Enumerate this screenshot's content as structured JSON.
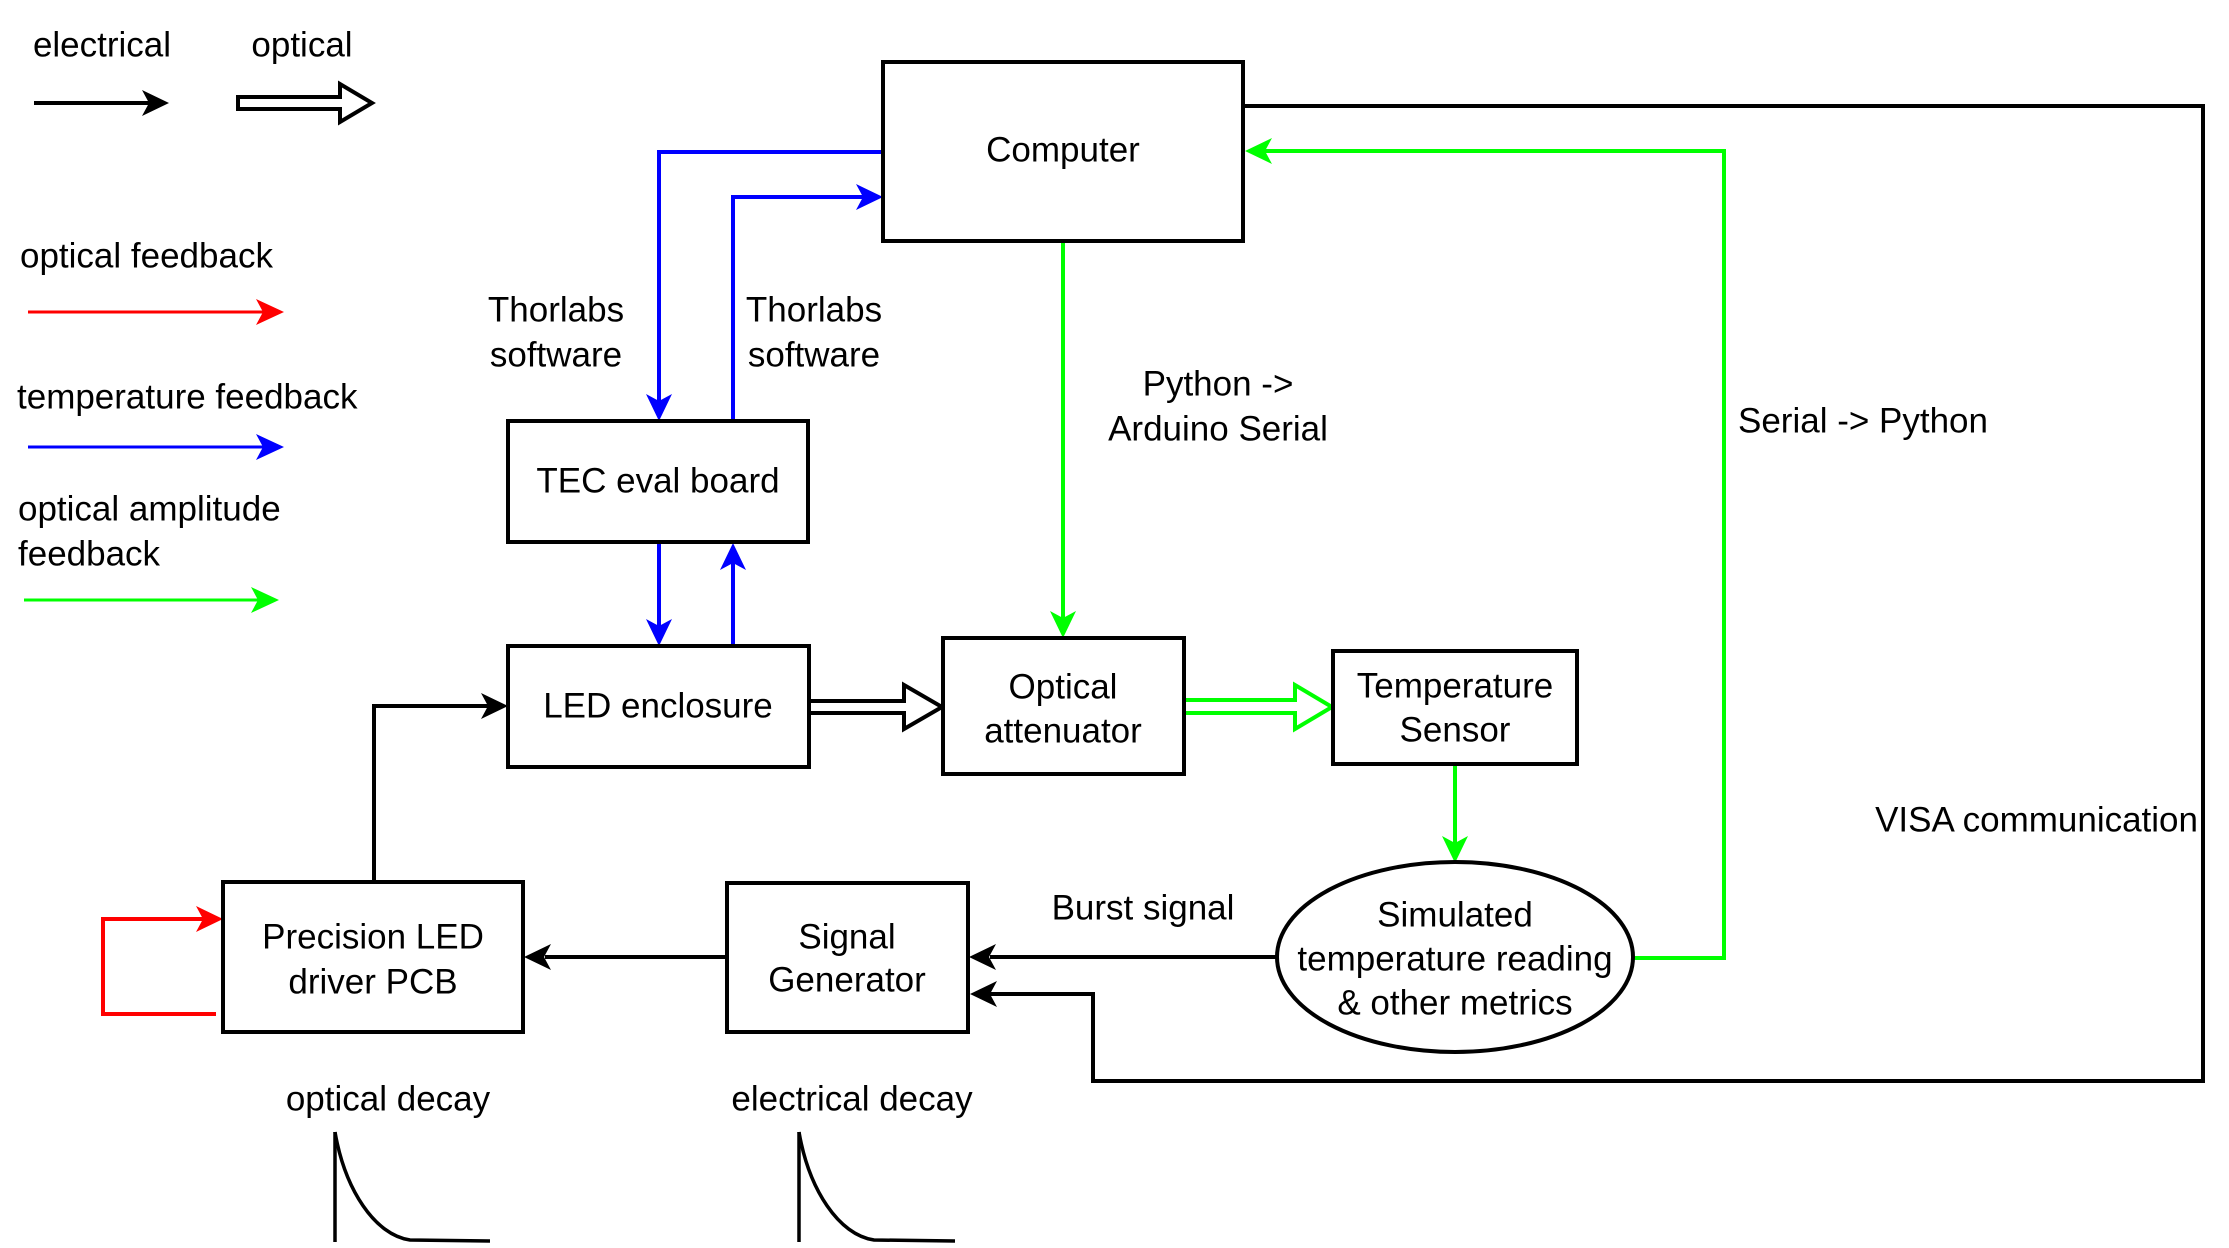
{
  "colors": {
    "electrical": "#000000",
    "optical_feedback": "#ff0000",
    "temperature_feedback": "#0000ff",
    "optical_amplitude_feedback": "#00ff00"
  },
  "legend": {
    "electrical": "electrical",
    "optical": "optical",
    "optical_feedback": "optical feedback",
    "temperature_feedback": "temperature feedback",
    "optical_amplitude_feedback_line1": "optical amplitude",
    "optical_amplitude_feedback_line2": "feedback"
  },
  "blocks": {
    "computer": "Computer",
    "tec_board": "TEC eval board",
    "led_enclosure": "LED enclosure",
    "optical_attenuator": [
      "Optical",
      "attenuator"
    ],
    "temperature_sensor": [
      "Temperature",
      "Sensor"
    ],
    "simulated_reading": [
      "Simulated",
      "temperature reading",
      "& other metrics"
    ],
    "signal_generator": [
      "Signal",
      "Generator"
    ],
    "led_driver": [
      "Precision LED",
      "driver PCB"
    ]
  },
  "labels": {
    "thorlabs_left": [
      "Thorlabs",
      "software"
    ],
    "thorlabs_right": [
      "Thorlabs",
      "software"
    ],
    "python_arduino": [
      "Python ->",
      "Arduino Serial"
    ],
    "serial_python": "Serial -> Python",
    "visa": "VISA communication",
    "burst_signal": "Burst signal",
    "optical_decay": "optical decay",
    "electrical_decay": "electrical decay"
  }
}
